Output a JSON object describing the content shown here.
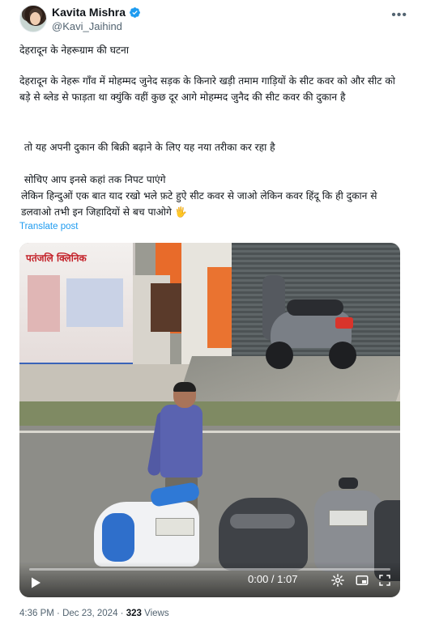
{
  "author": {
    "display_name": "Kavita Mishra",
    "handle": "@Kavi_Jaihind",
    "verified_icon": "verified-badge-icon",
    "verified_color": "#1d9bf0"
  },
  "tweet": {
    "p1": "देहरादून के नेहरूग्राम की घटना",
    "p2": "देहरादून के नेहरू गाँव में मोहम्मद जुनेद सड़क के किनारे खड़ी तमाम गाड़ियों के सीट कवर को और सीट को बड़े से ब्लेड से फाड़ता था क्युंकि वहीं कुछ दूर आगे मोहम्मद जुनैद की सीट कवर की दुकान है",
    "p3": " तो यह अपनी दुकान की बिक्री बढ़ाने के लिए यह नया तरीका कर रहा है",
    "p4": " सोचिए आप इनसे कहां तक निपट पाएंगे\nलेकिन हिन्दुओं एक बात याद रखो भले फ़टे हुऐ सीट कवर से जाओ लेकिन कवर हिंदू कि ही दुकान से डलवाओ तभी इन जिहादियों से बच पाओगे 🖐",
    "translate_label": "Translate post"
  },
  "video": {
    "sign_text": "पतंजलि क्लिनिक",
    "time_display": "0:00 / 1:07",
    "progress": 0,
    "icons": [
      "play-icon",
      "settings-icon",
      "picture-in-picture-icon",
      "fullscreen-icon"
    ]
  },
  "meta": {
    "time": "4:36 PM",
    "separator": " · ",
    "date": "Dec 23, 2024",
    "views_count": "323",
    "views_label": " Views"
  },
  "colors": {
    "link": "#1d9bf0",
    "secondary_text": "#536471"
  }
}
